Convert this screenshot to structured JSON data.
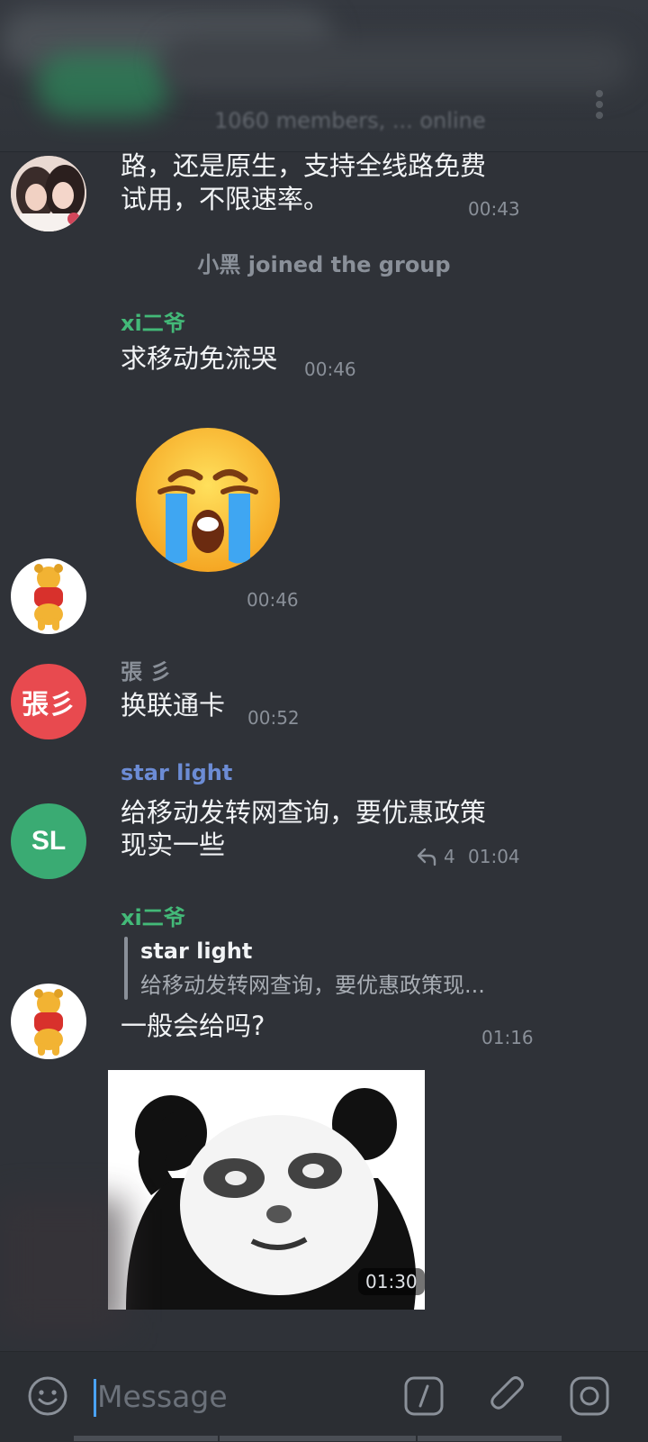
{
  "header": {
    "status": "1060 members, ... online"
  },
  "messages": [
    {
      "text_line1": "路，还是原生，支持全线路免费",
      "text_line2": "试用，不限速率。",
      "time": "00:43"
    },
    {
      "service": "小黑 joined the group"
    },
    {
      "sender": "xi二爷",
      "sender_color": "#43b978",
      "text": "求移动免流哭",
      "time": "00:46"
    },
    {
      "sticker": "crying-face-emoji",
      "time": "00:46"
    },
    {
      "sender": "張 彡",
      "sender_color": "#8a9099",
      "avatar_text": "張彡",
      "avatar_color": "#e84a4f",
      "text": "换联通卡",
      "time": "00:52"
    },
    {
      "sender": "star light",
      "sender_color": "#6c8cd5",
      "avatar_text": "SL",
      "avatar_color": "#3aab73",
      "text_line1": "给移动发转网查询，要优惠政策",
      "text_line2": "现实一些",
      "reply_count": "4",
      "time": "01:04"
    },
    {
      "sender": "xi二爷",
      "sender_color": "#43b978",
      "reply_to_name": "star light",
      "reply_to_text": "给移动发转网查询，要优惠政策现...",
      "text": "一般会给吗?",
      "time": "01:16"
    },
    {
      "sticker": "panda-meme-sticker",
      "time": "01:30"
    }
  ],
  "input": {
    "placeholder": "Message"
  },
  "icons": {
    "emoji": "smile-icon",
    "commands": "slash-command-icon",
    "attach": "paperclip-icon",
    "camera": "instagram-camera-icon"
  }
}
